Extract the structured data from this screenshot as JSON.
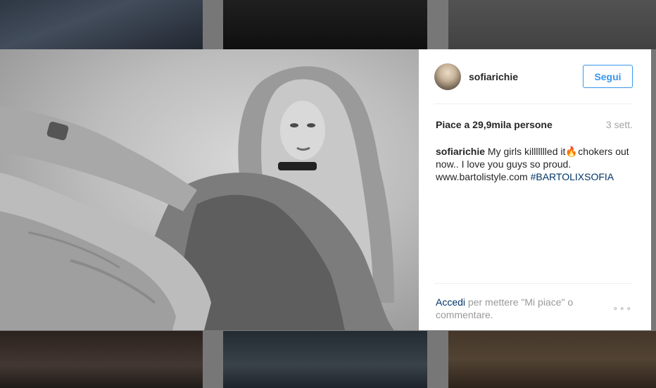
{
  "post": {
    "username": "sofiarichie",
    "follow_label": "Segui",
    "likes": "Piace a 29,9mila persone",
    "time": "3 sett.",
    "caption": {
      "user": "sofiarichie",
      "text_before_emoji": " My girls killllllled it",
      "emoji": "🔥",
      "text_after_emoji": " chokers out now.. I love you guys so proud. www.bartolistyle.com ",
      "hashtag": "#BARTOLIXSOFIA"
    },
    "footer": {
      "login_link": "Accedi",
      "login_text": " per mettere \"Mi piace\" o commentare.",
      "more_label": "∘∘∘"
    }
  },
  "icons": {
    "avatar": "user-avatar",
    "more": "more-options-icon"
  }
}
